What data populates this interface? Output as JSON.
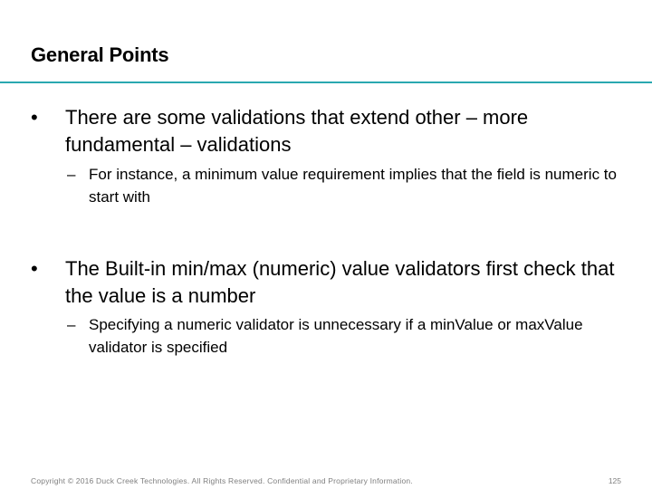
{
  "slide": {
    "title": "General Points",
    "bullets": [
      {
        "marker": "•",
        "text": "There are some validations that extend other – more fundamental – validations",
        "sub": {
          "marker": "–",
          "text": "For instance, a minimum value requirement implies that the field is numeric to start with"
        }
      },
      {
        "marker": "•",
        "text": "The Built-in min/max (numeric) value validators first check that the value is a number",
        "sub": {
          "marker": "–",
          "text": "Specifying a numeric validator is unnecessary if a minValue or maxValue validator is specified"
        }
      }
    ]
  },
  "footer": {
    "copyright": "Copyright © 2016 Duck Creek Technologies. All Rights Reserved. Confidential and Proprietary Information.",
    "page_number": "125"
  },
  "colors": {
    "accent_rule": "#2aa8b0",
    "footer_text": "#7f7f7f"
  }
}
